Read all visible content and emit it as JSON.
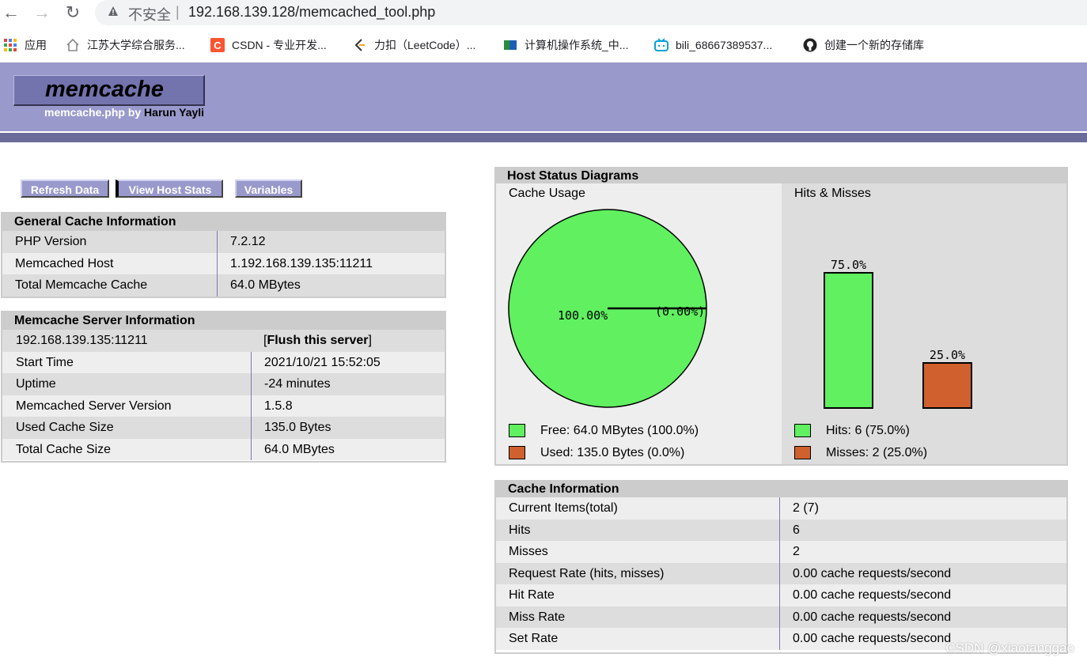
{
  "browser": {
    "insecure_label": "不安全",
    "separator": "|",
    "url": "192.168.139.128/memcached_tool.php",
    "bookmarks": [
      {
        "label": "应用",
        "icon": "apps-grid-icon"
      },
      {
        "label": "江苏大学综合服务...",
        "icon": "home-icon"
      },
      {
        "label": "CSDN - 专业开发...",
        "icon": "csdn-icon"
      },
      {
        "label": "力扣（LeetCode）...",
        "icon": "leetcode-icon"
      },
      {
        "label": "计算机操作系统_中...",
        "icon": "book-icon"
      },
      {
        "label": "bili_68667389537...",
        "icon": "bilibili-icon"
      },
      {
        "label": "创建一个新的存储库",
        "icon": "github-icon"
      }
    ]
  },
  "header": {
    "logo": "memcache",
    "sub_prefix": "memcache.php by ",
    "sub_author": "Harun Yayli"
  },
  "menu": {
    "refresh": "Refresh Data",
    "host_stats": "View Host Stats",
    "variables": "Variables"
  },
  "general": {
    "title": "General Cache Information",
    "rows": [
      {
        "k": "PHP Version",
        "v": "7.2.12"
      },
      {
        "k": "Memcached Host",
        "v": "1.192.168.139.135:11211"
      },
      {
        "k": "Total Memcache Cache",
        "v": "64.0 MBytes"
      }
    ]
  },
  "server": {
    "title": "Memcache Server Information",
    "host": "192.168.139.135:11211",
    "flush_open": "[",
    "flush_label": "Flush this server",
    "flush_close": "]",
    "rows": [
      {
        "k": "Start Time",
        "v": "2021/10/21 15:52:05"
      },
      {
        "k": "Uptime",
        "v": "-24 minutes"
      },
      {
        "k": "Memcached Server Version",
        "v": "1.5.8"
      },
      {
        "k": "Used Cache Size",
        "v": "135.0 Bytes"
      },
      {
        "k": "Total Cache Size",
        "v": "64.0 MBytes"
      }
    ]
  },
  "diagrams": {
    "title": "Host Status Diagrams",
    "usage_label": "Cache Usage",
    "hits_label": "Hits & Misses",
    "legend_free": "Free: 64.0 MBytes (100.0%)",
    "legend_used": "Used: 135.0 Bytes (0.0%)",
    "legend_hits": "Hits: 6 (75.0%)",
    "legend_misses": "Misses: 2 (25.0%)",
    "colors": {
      "free": "#60f060",
      "used": "#d0602e"
    }
  },
  "chart_data": [
    {
      "type": "pie",
      "title": "Cache Usage",
      "categories": [
        "Free",
        "Used"
      ],
      "values": [
        100.0,
        0.0
      ],
      "labels": [
        "100.00%",
        "(0.00%)"
      ]
    },
    {
      "type": "bar",
      "title": "Hits & Misses",
      "categories": [
        "Hits",
        "Misses"
      ],
      "values": [
        75.0,
        25.0
      ],
      "labels": [
        "75.0%",
        "25.0%"
      ],
      "ylim": [
        0,
        100
      ]
    }
  ],
  "cache": {
    "title": "Cache Information",
    "rows": [
      {
        "k": "Current Items(total)",
        "v": "2 (7)"
      },
      {
        "k": "Hits",
        "v": "6"
      },
      {
        "k": "Misses",
        "v": "2"
      },
      {
        "k": "Request Rate (hits, misses)",
        "v": "0.00 cache requests/second"
      },
      {
        "k": "Hit Rate",
        "v": "0.00 cache requests/second"
      },
      {
        "k": "Miss Rate",
        "v": "0.00 cache requests/second"
      },
      {
        "k": "Set Rate",
        "v": "0.00 cache requests/second"
      }
    ]
  },
  "watermark": "CSDN @xiaotanggao"
}
